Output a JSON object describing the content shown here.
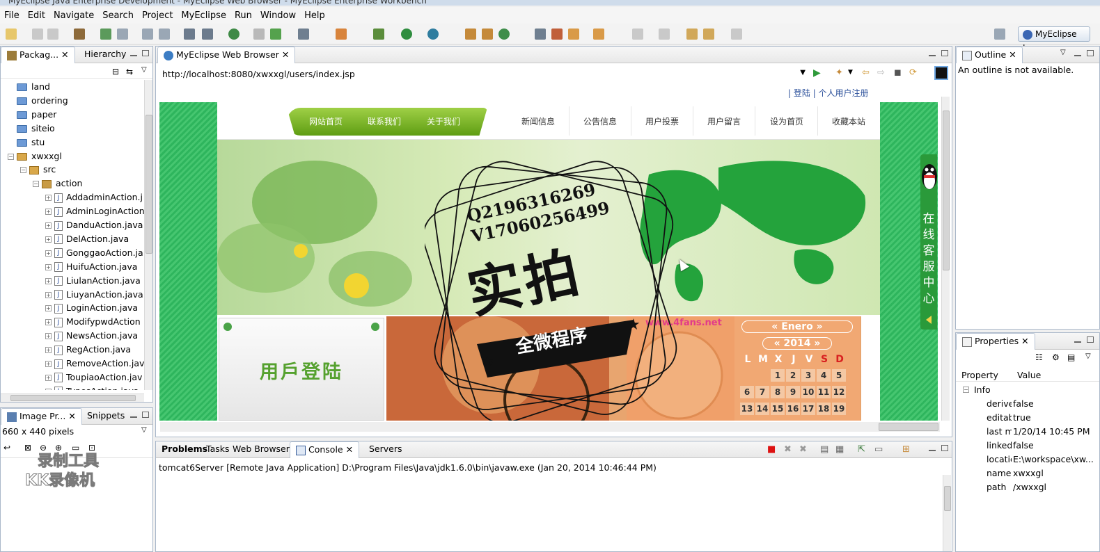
{
  "window": {
    "title": "MyEclipse Java Enterprise Development - MyEclipse Web Browser - MyEclipse Enterprise Workbench"
  },
  "menu": [
    "File",
    "Edit",
    "Navigate",
    "Search",
    "Project",
    "MyEclipse",
    "Run",
    "Window",
    "Help"
  ],
  "perspective": {
    "label": "MyEclipse J..."
  },
  "left_view": {
    "tabs": [
      "Packag...",
      "Hierarchy"
    ],
    "tree": [
      {
        "label": "land",
        "kind": "folder",
        "depth": 0
      },
      {
        "label": "ordering",
        "kind": "folder",
        "depth": 0
      },
      {
        "label": "paper",
        "kind": "folder",
        "depth": 0
      },
      {
        "label": "siteio",
        "kind": "folder",
        "depth": 0
      },
      {
        "label": "stu",
        "kind": "folder",
        "depth": 0
      },
      {
        "label": "xwxxgl",
        "kind": "project",
        "depth": 0
      },
      {
        "label": "src",
        "kind": "src",
        "depth": 1
      },
      {
        "label": "action",
        "kind": "package",
        "depth": 2
      },
      {
        "label": "AddadminAction.j",
        "kind": "java",
        "depth": 3
      },
      {
        "label": "AdminLoginAction",
        "kind": "java",
        "depth": 3
      },
      {
        "label": "DanduAction.java",
        "kind": "java",
        "depth": 3
      },
      {
        "label": "DelAction.java",
        "kind": "java",
        "depth": 3
      },
      {
        "label": "GonggaoAction.ja",
        "kind": "java",
        "depth": 3
      },
      {
        "label": "HuifuAction.java",
        "kind": "java",
        "depth": 3
      },
      {
        "label": "LiulanAction.java",
        "kind": "java",
        "depth": 3
      },
      {
        "label": "LiuyanAction.java",
        "kind": "java",
        "depth": 3
      },
      {
        "label": "LoginAction.java",
        "kind": "java",
        "depth": 3
      },
      {
        "label": "ModifypwdAction",
        "kind": "java",
        "depth": 3
      },
      {
        "label": "NewsAction.java",
        "kind": "java",
        "depth": 3
      },
      {
        "label": "RegAction.java",
        "kind": "java",
        "depth": 3
      },
      {
        "label": "RemoveAction.jav",
        "kind": "java",
        "depth": 3
      },
      {
        "label": "ToupiaoAction.jav",
        "kind": "java",
        "depth": 3
      },
      {
        "label": "TypesAction.java",
        "kind": "java",
        "depth": 3
      }
    ]
  },
  "image_view": {
    "tabs": [
      "Image Pr...",
      "Snippets"
    ],
    "size_text": "660 x 440 pixels"
  },
  "browser": {
    "tab": "MyEclipse Web Browser",
    "url": "http://localhost:8080/xwxxgl/users/index.jsp",
    "top_links": [
      "登陆",
      "个人用户注册"
    ],
    "green_nav": [
      "网站首页",
      "联系我们",
      "关于我们"
    ],
    "right_nav": [
      "新闻信息",
      "公告信息",
      "用户投票",
      "用户留言",
      "设为首页",
      "收藏本站"
    ],
    "login_title": "用戶登陆",
    "side_service": [
      "在",
      "线",
      "客",
      "服",
      "中",
      "心"
    ],
    "calendar": {
      "month": "Enero",
      "year": "2014",
      "weekdays": [
        "L",
        "M",
        "X",
        "J",
        "V",
        "S",
        "D"
      ],
      "rows": [
        [
          "",
          "",
          "",
          "1",
          "2",
          "3",
          "4",
          "5"
        ],
        [
          "6",
          "7",
          "8",
          "9",
          "10",
          "11",
          "12"
        ],
        [
          "13",
          "14",
          "15",
          "16",
          "17",
          "18",
          "19"
        ]
      ]
    },
    "flash_site": "www.4fans.net"
  },
  "outline": {
    "tab": "Outline",
    "message": "An outline is not available."
  },
  "properties": {
    "tab": "Properties",
    "columns": [
      "Property",
      "Value"
    ],
    "group": "Info",
    "rows": [
      {
        "key": "derive",
        "value": "false"
      },
      {
        "key": "editab",
        "value": "true"
      },
      {
        "key": "last m",
        "value": "1/20/14 10:45 PM"
      },
      {
        "key": "linked",
        "value": "false"
      },
      {
        "key": "locatic",
        "value": "E:\\workspace\\xw..."
      },
      {
        "key": "name",
        "value": "xwxxgl"
      },
      {
        "key": "path",
        "value": "/xwxxgl"
      }
    ]
  },
  "bottom": {
    "tabs": [
      "Problems",
      "Tasks",
      "Web Browser",
      "Console",
      "Servers"
    ],
    "console_line": "tomcat6Server [Remote Java Application] D:\\Program Files\\Java\\jdk1.6.0\\bin\\javaw.exe (Jan 20, 2014 10:46:44 PM)"
  },
  "watermark": {
    "q": "Q2196316269",
    "v": "V17060256499",
    "big": "实拍",
    "ribbon": "全微程序",
    "recorder": [
      "录制工具",
      "KK录像机"
    ]
  },
  "colors": {
    "accent": "#2eb55d",
    "nav_green": "#7bb82a",
    "frame": "#a9b7c9"
  }
}
